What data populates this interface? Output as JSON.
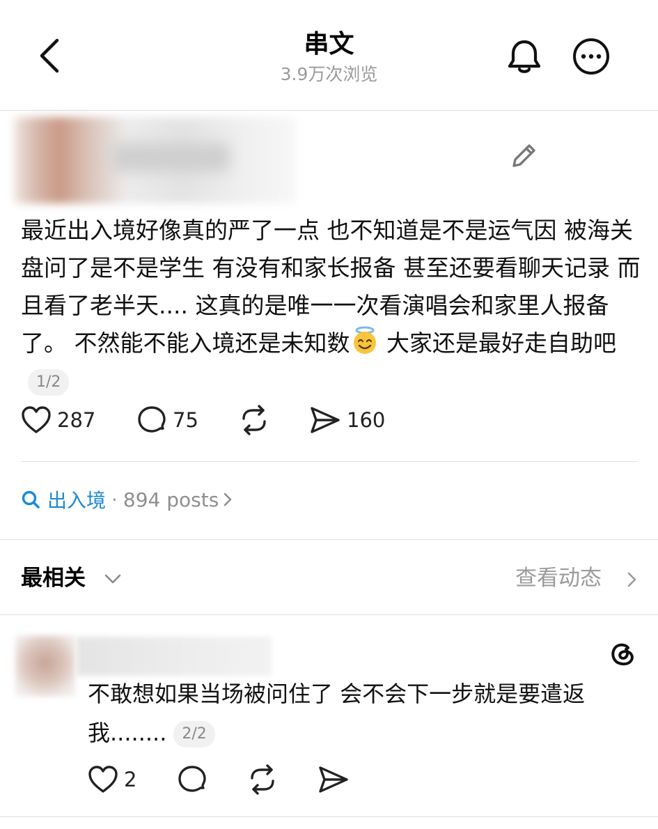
{
  "header": {
    "title": "串文",
    "views": "3.9万次浏览"
  },
  "post": {
    "text": "最近出入境好像真的严了一点 也不知道是不是运气因 被海关盘问了是不是学生 有没有和家长报备 甚至还要看聊天记录 而且看了老半天.... 这真的是唯一一次看演唱会和家里人报备了。 不然能不能入境还是未知数",
    "emoji": "smiling-face-with-halo",
    "text_after_emoji": " 大家还是最好走自助吧",
    "pager": "1/2",
    "likes": "287",
    "comments": "75",
    "shares": "160"
  },
  "tag": {
    "name": "出入境",
    "separator": "·",
    "count": "894 posts"
  },
  "sort": {
    "label": "最相关",
    "activity_link": "查看动态"
  },
  "reply": {
    "text": "不敢想如果当场被问住了 会不会下一步就是要遣返我........",
    "pager": "2/2",
    "likes": "2"
  },
  "colors": {
    "accent": "#1a8ad8",
    "muted": "#9a9a9a",
    "divider": "#dedede"
  }
}
